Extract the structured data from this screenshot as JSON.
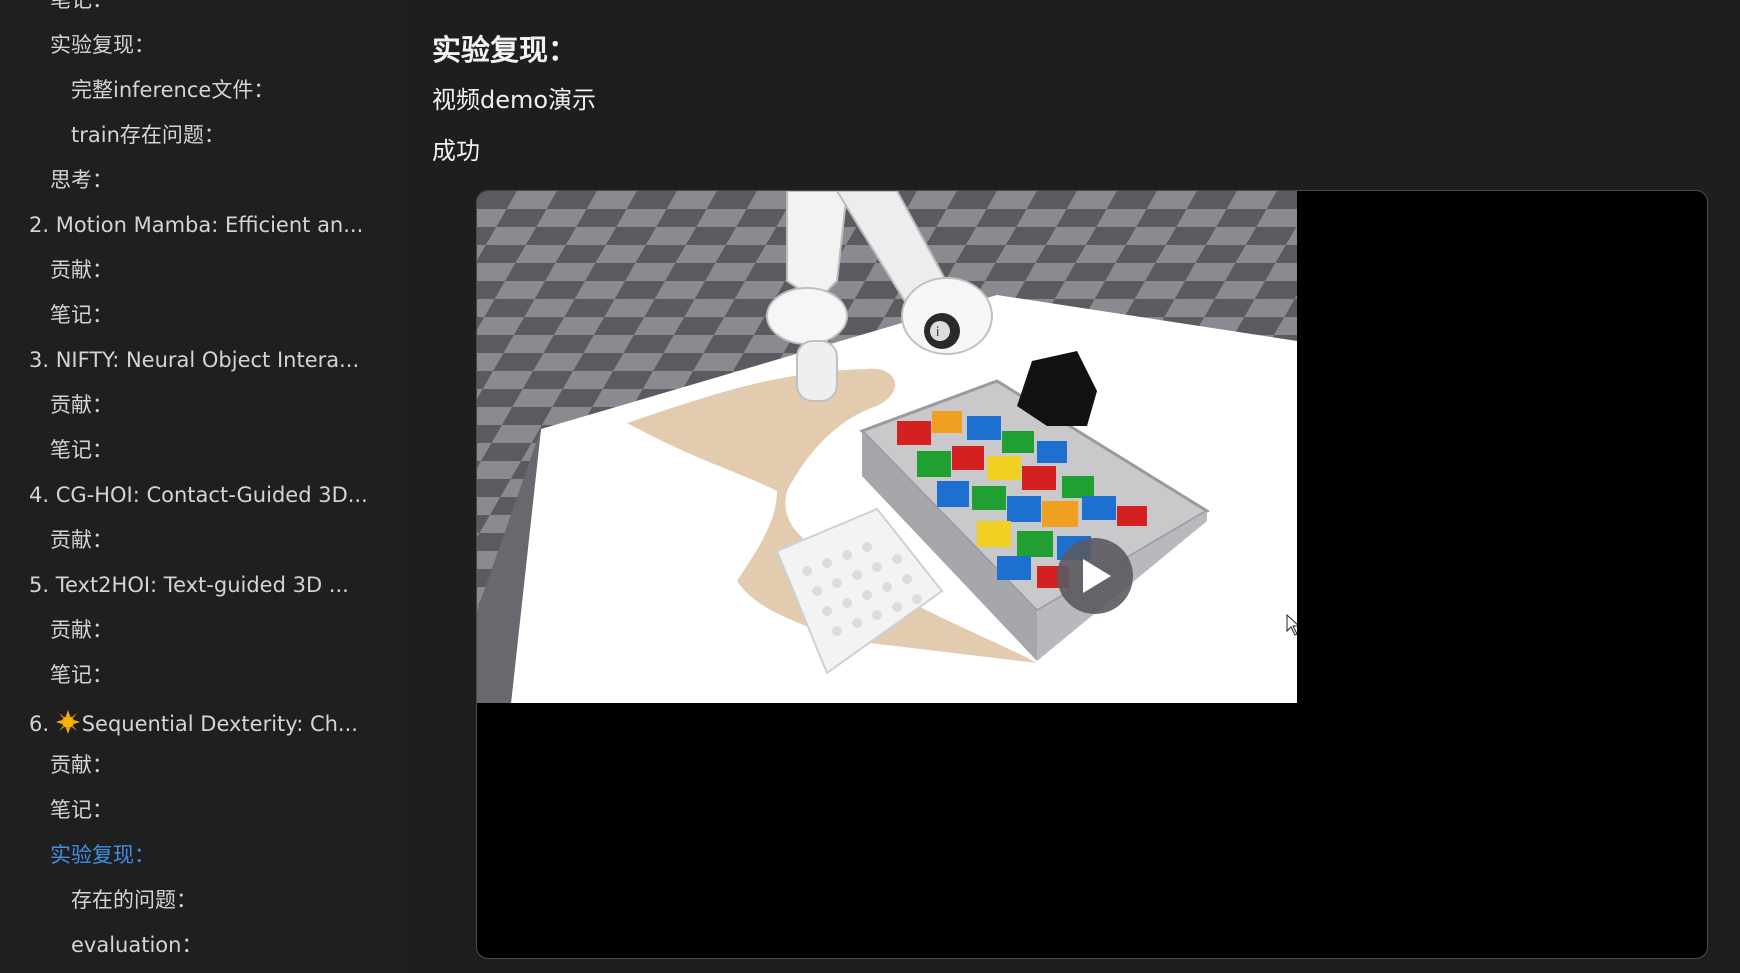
{
  "toc": [
    {
      "label": "笔记：",
      "level": 2,
      "active": false
    },
    {
      "label": "实验复现：",
      "level": 2,
      "active": false
    },
    {
      "label": "完整inference文件：",
      "level": 3,
      "active": false
    },
    {
      "label": "train存在问题：",
      "level": 3,
      "active": false
    },
    {
      "label": "思考：",
      "level": 2,
      "active": false
    },
    {
      "label": "2. Motion Mamba: Efficient an...",
      "level": 1,
      "active": false
    },
    {
      "label": "贡献：",
      "level": 2,
      "active": false
    },
    {
      "label": "笔记：",
      "level": 2,
      "active": false
    },
    {
      "label": "3. NIFTY: Neural Object Intera...",
      "level": 1,
      "active": false
    },
    {
      "label": "贡献：",
      "level": 2,
      "active": false
    },
    {
      "label": "笔记：",
      "level": 2,
      "active": false
    },
    {
      "label": "4. CG-HOI: Contact-Guided 3D...",
      "level": 1,
      "active": false
    },
    {
      "label": "贡献：",
      "level": 2,
      "active": false
    },
    {
      "label": "5. Text2HOI: Text-guided 3D ...",
      "level": 1,
      "active": false
    },
    {
      "label": "贡献：",
      "level": 2,
      "active": false
    },
    {
      "label": "笔记：",
      "level": 2,
      "active": false
    },
    {
      "label": "Sequential Dexterity: Ch...",
      "prefix": "6.",
      "icon": "sun-icon",
      "level": 1,
      "active": false
    },
    {
      "label": "贡献：",
      "level": 2,
      "active": false
    },
    {
      "label": "笔记：",
      "level": 2,
      "active": false
    },
    {
      "label": "实验复现：",
      "level": 2,
      "active": true
    },
    {
      "label": "存在的问题：",
      "level": 3,
      "active": false
    },
    {
      "label": "evaluation：",
      "level": 3,
      "active": false
    }
  ],
  "main": {
    "heading": "实验复现：",
    "line1": "视频demo演示",
    "line2": "成功"
  },
  "video": {
    "play_icon": "play-icon",
    "robot_label": "i"
  },
  "colors": {
    "background": "#1e1e1e",
    "active_link": "#3f8fe6",
    "text": "#d4d4d4"
  }
}
